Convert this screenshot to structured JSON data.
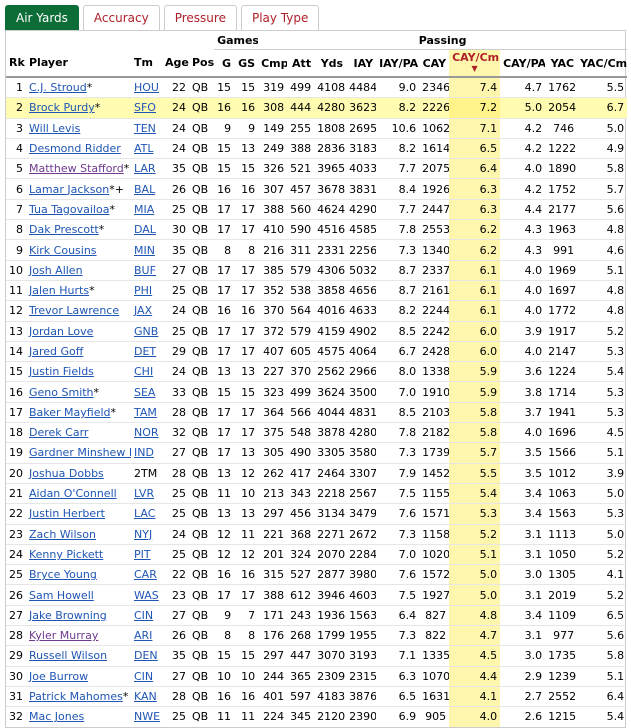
{
  "tabs": [
    {
      "label": "Air Yards",
      "active": true
    },
    {
      "label": "Accuracy",
      "active": false
    },
    {
      "label": "Pressure",
      "active": false
    },
    {
      "label": "Play Type",
      "active": false
    }
  ],
  "table": {
    "group_headers": {
      "games": "Games",
      "passing": "Passing"
    },
    "columns": [
      "Rk",
      "Player",
      "Tm",
      "Age",
      "Pos",
      "G",
      "GS",
      "Cmp",
      "Att",
      "Yds",
      "IAY",
      "IAY/PA",
      "CAY",
      "CAY/Cmp",
      "CAY/PA",
      "YAC",
      "YAC/Cmp"
    ],
    "sorted_column": "CAY/Cmp",
    "sort_arrow": "▼",
    "rows": [
      {
        "rk": "1",
        "player": "C.J. Stroud",
        "mark": "*",
        "tm": "HOU",
        "age": "22",
        "pos": "QB",
        "g": "15",
        "gs": "15",
        "cmp": "319",
        "att": "499",
        "yds": "4108",
        "iay": "4484",
        "iay_pa": "9.0",
        "cay": "2346",
        "cay_cmp": "7.4",
        "cay_pa": "4.7",
        "yac": "1762",
        "yac_cmp": "5.5"
      },
      {
        "rk": "2",
        "player": "Brock Purdy",
        "mark": "*",
        "tm": "SFO",
        "age": "24",
        "pos": "QB",
        "g": "16",
        "gs": "16",
        "cmp": "308",
        "att": "444",
        "yds": "4280",
        "iay": "3623",
        "iay_pa": "8.2",
        "cay": "2226",
        "cay_cmp": "7.2",
        "cay_pa": "5.0",
        "yac": "2054",
        "yac_cmp": "6.7",
        "highlight": true
      },
      {
        "rk": "3",
        "player": "Will Levis",
        "mark": "",
        "tm": "TEN",
        "age": "24",
        "pos": "QB",
        "g": "9",
        "gs": "9",
        "cmp": "149",
        "att": "255",
        "yds": "1808",
        "iay": "2695",
        "iay_pa": "10.6",
        "cay": "1062",
        "cay_cmp": "7.1",
        "cay_pa": "4.2",
        "yac": "746",
        "yac_cmp": "5.0"
      },
      {
        "rk": "4",
        "player": "Desmond Ridder",
        "mark": "",
        "tm": "ATL",
        "age": "24",
        "pos": "QB",
        "g": "15",
        "gs": "13",
        "cmp": "249",
        "att": "388",
        "yds": "2836",
        "iay": "3183",
        "iay_pa": "8.2",
        "cay": "1614",
        "cay_cmp": "6.5",
        "cay_pa": "4.2",
        "yac": "1222",
        "yac_cmp": "4.9"
      },
      {
        "rk": "5",
        "player": "Matthew Stafford",
        "mark": "*",
        "tm": "LAR",
        "age": "35",
        "pos": "QB",
        "g": "15",
        "gs": "15",
        "cmp": "326",
        "att": "521",
        "yds": "3965",
        "iay": "4033",
        "iay_pa": "7.7",
        "cay": "2075",
        "cay_cmp": "6.4",
        "cay_pa": "4.0",
        "yac": "1890",
        "yac_cmp": "5.8",
        "visited": true
      },
      {
        "rk": "6",
        "player": "Lamar Jackson",
        "mark": "*+",
        "tm": "BAL",
        "age": "26",
        "pos": "QB",
        "g": "16",
        "gs": "16",
        "cmp": "307",
        "att": "457",
        "yds": "3678",
        "iay": "3831",
        "iay_pa": "8.4",
        "cay": "1926",
        "cay_cmp": "6.3",
        "cay_pa": "4.2",
        "yac": "1752",
        "yac_cmp": "5.7"
      },
      {
        "rk": "7",
        "player": "Tua Tagovailoa",
        "mark": "*",
        "tm": "MIA",
        "age": "25",
        "pos": "QB",
        "g": "17",
        "gs": "17",
        "cmp": "388",
        "att": "560",
        "yds": "4624",
        "iay": "4290",
        "iay_pa": "7.7",
        "cay": "2447",
        "cay_cmp": "6.3",
        "cay_pa": "4.4",
        "yac": "2177",
        "yac_cmp": "5.6"
      },
      {
        "rk": "8",
        "player": "Dak Prescott",
        "mark": "*",
        "tm": "DAL",
        "age": "30",
        "pos": "QB",
        "g": "17",
        "gs": "17",
        "cmp": "410",
        "att": "590",
        "yds": "4516",
        "iay": "4585",
        "iay_pa": "7.8",
        "cay": "2553",
        "cay_cmp": "6.2",
        "cay_pa": "4.3",
        "yac": "1963",
        "yac_cmp": "4.8"
      },
      {
        "rk": "9",
        "player": "Kirk Cousins",
        "mark": "",
        "tm": "MIN",
        "age": "35",
        "pos": "QB",
        "g": "8",
        "gs": "8",
        "cmp": "216",
        "att": "311",
        "yds": "2331",
        "iay": "2256",
        "iay_pa": "7.3",
        "cay": "1340",
        "cay_cmp": "6.2",
        "cay_pa": "4.3",
        "yac": "991",
        "yac_cmp": "4.6"
      },
      {
        "rk": "10",
        "player": "Josh Allen",
        "mark": "",
        "tm": "BUF",
        "age": "27",
        "pos": "QB",
        "g": "17",
        "gs": "17",
        "cmp": "385",
        "att": "579",
        "yds": "4306",
        "iay": "5032",
        "iay_pa": "8.7",
        "cay": "2337",
        "cay_cmp": "6.1",
        "cay_pa": "4.0",
        "yac": "1969",
        "yac_cmp": "5.1"
      },
      {
        "rk": "11",
        "player": "Jalen Hurts",
        "mark": "*",
        "tm": "PHI",
        "age": "25",
        "pos": "QB",
        "g": "17",
        "gs": "17",
        "cmp": "352",
        "att": "538",
        "yds": "3858",
        "iay": "4656",
        "iay_pa": "8.7",
        "cay": "2161",
        "cay_cmp": "6.1",
        "cay_pa": "4.0",
        "yac": "1697",
        "yac_cmp": "4.8"
      },
      {
        "rk": "12",
        "player": "Trevor Lawrence",
        "mark": "",
        "tm": "JAX",
        "age": "24",
        "pos": "QB",
        "g": "16",
        "gs": "16",
        "cmp": "370",
        "att": "564",
        "yds": "4016",
        "iay": "4633",
        "iay_pa": "8.2",
        "cay": "2244",
        "cay_cmp": "6.1",
        "cay_pa": "4.0",
        "yac": "1772",
        "yac_cmp": "4.8"
      },
      {
        "rk": "13",
        "player": "Jordan Love",
        "mark": "",
        "tm": "GNB",
        "age": "25",
        "pos": "QB",
        "g": "17",
        "gs": "17",
        "cmp": "372",
        "att": "579",
        "yds": "4159",
        "iay": "4902",
        "iay_pa": "8.5",
        "cay": "2242",
        "cay_cmp": "6.0",
        "cay_pa": "3.9",
        "yac": "1917",
        "yac_cmp": "5.2"
      },
      {
        "rk": "14",
        "player": "Jared Goff",
        "mark": "",
        "tm": "DET",
        "age": "29",
        "pos": "QB",
        "g": "17",
        "gs": "17",
        "cmp": "407",
        "att": "605",
        "yds": "4575",
        "iay": "4064",
        "iay_pa": "6.7",
        "cay": "2428",
        "cay_cmp": "6.0",
        "cay_pa": "4.0",
        "yac": "2147",
        "yac_cmp": "5.3"
      },
      {
        "rk": "15",
        "player": "Justin Fields",
        "mark": "",
        "tm": "CHI",
        "age": "24",
        "pos": "QB",
        "g": "13",
        "gs": "13",
        "cmp": "227",
        "att": "370",
        "yds": "2562",
        "iay": "2966",
        "iay_pa": "8.0",
        "cay": "1338",
        "cay_cmp": "5.9",
        "cay_pa": "3.6",
        "yac": "1224",
        "yac_cmp": "5.4"
      },
      {
        "rk": "16",
        "player": "Geno Smith",
        "mark": "*",
        "tm": "SEA",
        "age": "33",
        "pos": "QB",
        "g": "15",
        "gs": "15",
        "cmp": "323",
        "att": "499",
        "yds": "3624",
        "iay": "3500",
        "iay_pa": "7.0",
        "cay": "1910",
        "cay_cmp": "5.9",
        "cay_pa": "3.8",
        "yac": "1714",
        "yac_cmp": "5.3"
      },
      {
        "rk": "17",
        "player": "Baker Mayfield",
        "mark": "*",
        "tm": "TAM",
        "age": "28",
        "pos": "QB",
        "g": "17",
        "gs": "17",
        "cmp": "364",
        "att": "566",
        "yds": "4044",
        "iay": "4831",
        "iay_pa": "8.5",
        "cay": "2103",
        "cay_cmp": "5.8",
        "cay_pa": "3.7",
        "yac": "1941",
        "yac_cmp": "5.3"
      },
      {
        "rk": "18",
        "player": "Derek Carr",
        "mark": "",
        "tm": "NOR",
        "age": "32",
        "pos": "QB",
        "g": "17",
        "gs": "17",
        "cmp": "375",
        "att": "548",
        "yds": "3878",
        "iay": "4280",
        "iay_pa": "7.8",
        "cay": "2182",
        "cay_cmp": "5.8",
        "cay_pa": "4.0",
        "yac": "1696",
        "yac_cmp": "4.5"
      },
      {
        "rk": "19",
        "player": "Gardner Minshew II",
        "mark": "*",
        "tm": "IND",
        "age": "27",
        "pos": "QB",
        "g": "17",
        "gs": "13",
        "cmp": "305",
        "att": "490",
        "yds": "3305",
        "iay": "3580",
        "iay_pa": "7.3",
        "cay": "1739",
        "cay_cmp": "5.7",
        "cay_pa": "3.5",
        "yac": "1566",
        "yac_cmp": "5.1"
      },
      {
        "rk": "20",
        "player": "Joshua Dobbs",
        "mark": "",
        "tm": "2TM",
        "age": "28",
        "pos": "QB",
        "g": "13",
        "gs": "12",
        "cmp": "262",
        "att": "417",
        "yds": "2464",
        "iay": "3307",
        "iay_pa": "7.9",
        "cay": "1452",
        "cay_cmp": "5.5",
        "cay_pa": "3.5",
        "yac": "1012",
        "yac_cmp": "3.9",
        "no_team_link": true
      },
      {
        "rk": "21",
        "player": "Aidan O'Connell",
        "mark": "",
        "tm": "LVR",
        "age": "25",
        "pos": "QB",
        "g": "11",
        "gs": "10",
        "cmp": "213",
        "att": "343",
        "yds": "2218",
        "iay": "2567",
        "iay_pa": "7.5",
        "cay": "1155",
        "cay_cmp": "5.4",
        "cay_pa": "3.4",
        "yac": "1063",
        "yac_cmp": "5.0"
      },
      {
        "rk": "22",
        "player": "Justin Herbert",
        "mark": "",
        "tm": "LAC",
        "age": "25",
        "pos": "QB",
        "g": "13",
        "gs": "13",
        "cmp": "297",
        "att": "456",
        "yds": "3134",
        "iay": "3479",
        "iay_pa": "7.6",
        "cay": "1571",
        "cay_cmp": "5.3",
        "cay_pa": "3.4",
        "yac": "1563",
        "yac_cmp": "5.3"
      },
      {
        "rk": "23",
        "player": "Zach Wilson",
        "mark": "",
        "tm": "NYJ",
        "age": "24",
        "pos": "QB",
        "g": "12",
        "gs": "11",
        "cmp": "221",
        "att": "368",
        "yds": "2271",
        "iay": "2672",
        "iay_pa": "7.3",
        "cay": "1158",
        "cay_cmp": "5.2",
        "cay_pa": "3.1",
        "yac": "1113",
        "yac_cmp": "5.0"
      },
      {
        "rk": "24",
        "player": "Kenny Pickett",
        "mark": "",
        "tm": "PIT",
        "age": "25",
        "pos": "QB",
        "g": "12",
        "gs": "12",
        "cmp": "201",
        "att": "324",
        "yds": "2070",
        "iay": "2284",
        "iay_pa": "7.0",
        "cay": "1020",
        "cay_cmp": "5.1",
        "cay_pa": "3.1",
        "yac": "1050",
        "yac_cmp": "5.2"
      },
      {
        "rk": "25",
        "player": "Bryce Young",
        "mark": "",
        "tm": "CAR",
        "age": "22",
        "pos": "QB",
        "g": "16",
        "gs": "16",
        "cmp": "315",
        "att": "527",
        "yds": "2877",
        "iay": "3980",
        "iay_pa": "7.6",
        "cay": "1572",
        "cay_cmp": "5.0",
        "cay_pa": "3.0",
        "yac": "1305",
        "yac_cmp": "4.1"
      },
      {
        "rk": "26",
        "player": "Sam Howell",
        "mark": "",
        "tm": "WAS",
        "age": "23",
        "pos": "QB",
        "g": "17",
        "gs": "17",
        "cmp": "388",
        "att": "612",
        "yds": "3946",
        "iay": "4603",
        "iay_pa": "7.5",
        "cay": "1927",
        "cay_cmp": "5.0",
        "cay_pa": "3.1",
        "yac": "2019",
        "yac_cmp": "5.2"
      },
      {
        "rk": "27",
        "player": "Jake Browning",
        "mark": "",
        "tm": "CIN",
        "age": "27",
        "pos": "QB",
        "g": "9",
        "gs": "7",
        "cmp": "171",
        "att": "243",
        "yds": "1936",
        "iay": "1563",
        "iay_pa": "6.4",
        "cay": "827",
        "cay_cmp": "4.8",
        "cay_pa": "3.4",
        "yac": "1109",
        "yac_cmp": "6.5"
      },
      {
        "rk": "28",
        "player": "Kyler Murray",
        "mark": "",
        "tm": "ARI",
        "age": "26",
        "pos": "QB",
        "g": "8",
        "gs": "8",
        "cmp": "176",
        "att": "268",
        "yds": "1799",
        "iay": "1955",
        "iay_pa": "7.3",
        "cay": "822",
        "cay_cmp": "4.7",
        "cay_pa": "3.1",
        "yac": "977",
        "yac_cmp": "5.6",
        "visited": true
      },
      {
        "rk": "29",
        "player": "Russell Wilson",
        "mark": "",
        "tm": "DEN",
        "age": "35",
        "pos": "QB",
        "g": "15",
        "gs": "15",
        "cmp": "297",
        "att": "447",
        "yds": "3070",
        "iay": "3193",
        "iay_pa": "7.1",
        "cay": "1335",
        "cay_cmp": "4.5",
        "cay_pa": "3.0",
        "yac": "1735",
        "yac_cmp": "5.8"
      },
      {
        "rk": "30",
        "player": "Joe Burrow",
        "mark": "",
        "tm": "CIN",
        "age": "27",
        "pos": "QB",
        "g": "10",
        "gs": "10",
        "cmp": "244",
        "att": "365",
        "yds": "2309",
        "iay": "2315",
        "iay_pa": "6.3",
        "cay": "1070",
        "cay_cmp": "4.4",
        "cay_pa": "2.9",
        "yac": "1239",
        "yac_cmp": "5.1"
      },
      {
        "rk": "31",
        "player": "Patrick Mahomes",
        "mark": "*",
        "tm": "KAN",
        "age": "28",
        "pos": "QB",
        "g": "16",
        "gs": "16",
        "cmp": "401",
        "att": "597",
        "yds": "4183",
        "iay": "3876",
        "iay_pa": "6.5",
        "cay": "1631",
        "cay_cmp": "4.1",
        "cay_pa": "2.7",
        "yac": "2552",
        "yac_cmp": "6.4"
      },
      {
        "rk": "32",
        "player": "Mac Jones",
        "mark": "",
        "tm": "NWE",
        "age": "25",
        "pos": "QB",
        "g": "11",
        "gs": "11",
        "cmp": "224",
        "att": "345",
        "yds": "2120",
        "iay": "2390",
        "iay_pa": "6.9",
        "cay": "905",
        "cay_cmp": "4.0",
        "cay_pa": "2.6",
        "yac": "1215",
        "yac_cmp": "5.4"
      }
    ]
  }
}
